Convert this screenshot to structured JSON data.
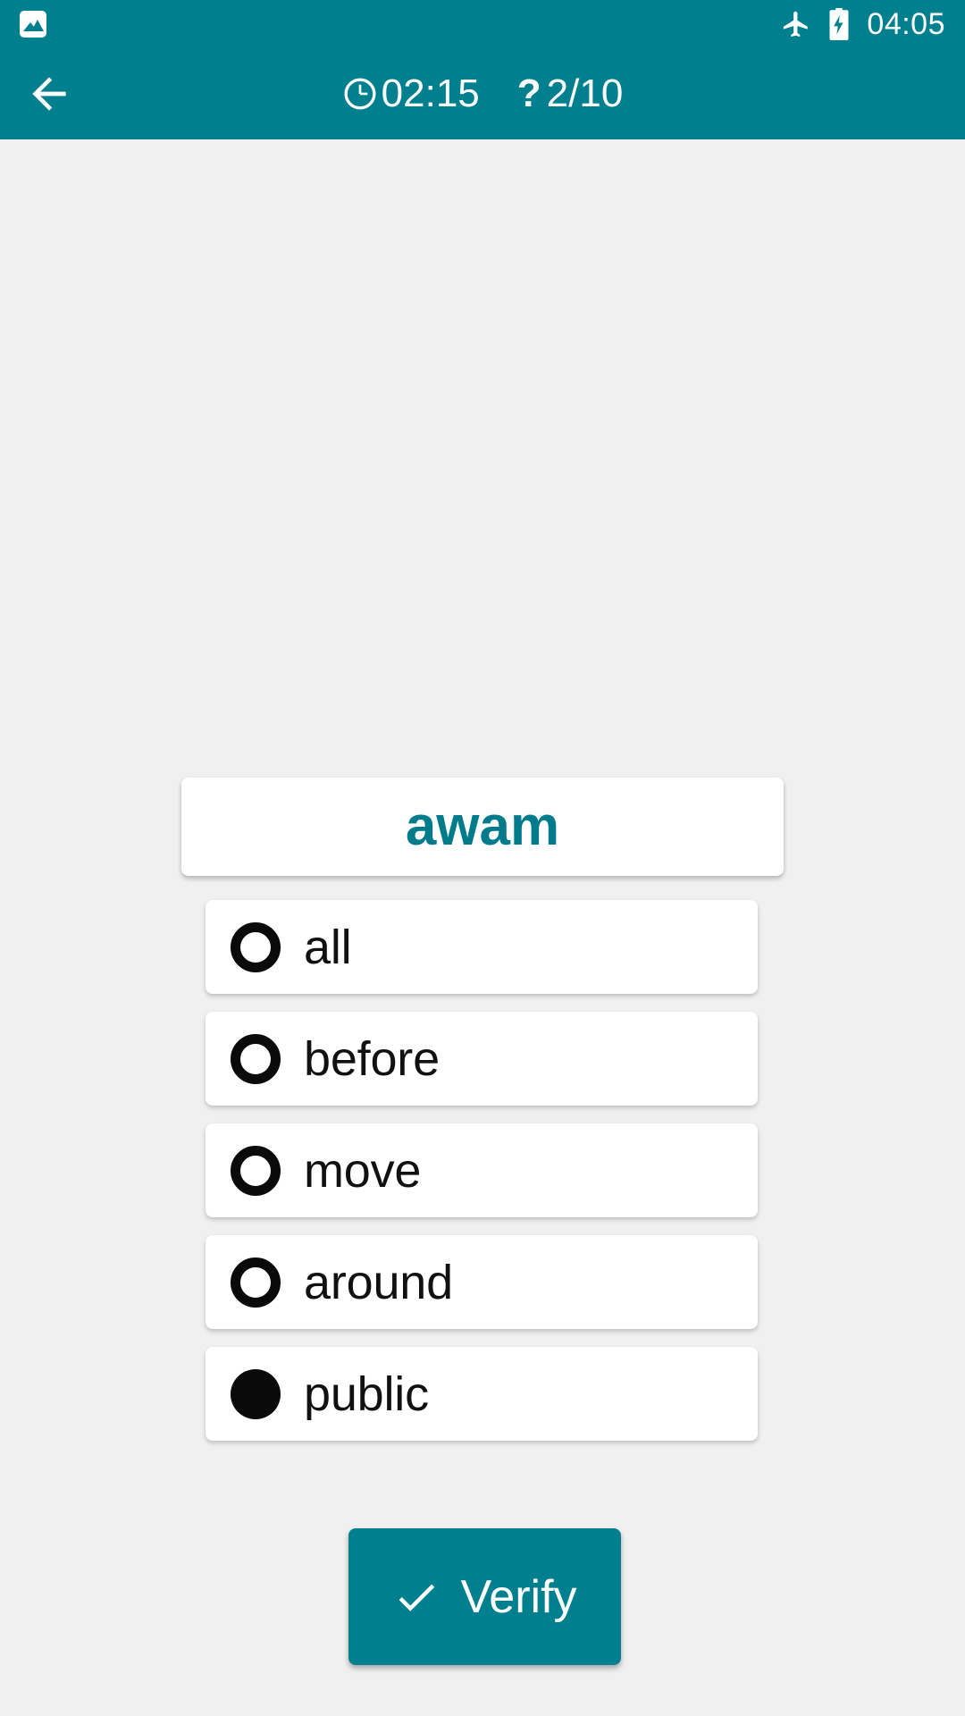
{
  "theme": {
    "primary": "#00808f",
    "word_color": "#007b8c",
    "background": "#f0f0f0",
    "card": "#ffffff",
    "radio": "#0a0a0a"
  },
  "status_bar": {
    "notification_icon": "photo-icon",
    "airplane_icon": "airplane-mode-icon",
    "battery_icon": "battery-charging-icon",
    "time": "04:05"
  },
  "app_bar": {
    "back_icon": "back-arrow-icon",
    "timer": {
      "icon": "clock-icon",
      "value": "02:15"
    },
    "progress": {
      "icon": "question-mark-icon",
      "symbol": "?",
      "value": "2/10"
    }
  },
  "quiz": {
    "word": "awam",
    "options": [
      {
        "label": "all",
        "selected": false
      },
      {
        "label": "before",
        "selected": false
      },
      {
        "label": "move",
        "selected": false
      },
      {
        "label": "around",
        "selected": false
      },
      {
        "label": "public",
        "selected": true
      }
    ],
    "verify_button": {
      "label": "Verify",
      "icon": "check-icon"
    }
  }
}
